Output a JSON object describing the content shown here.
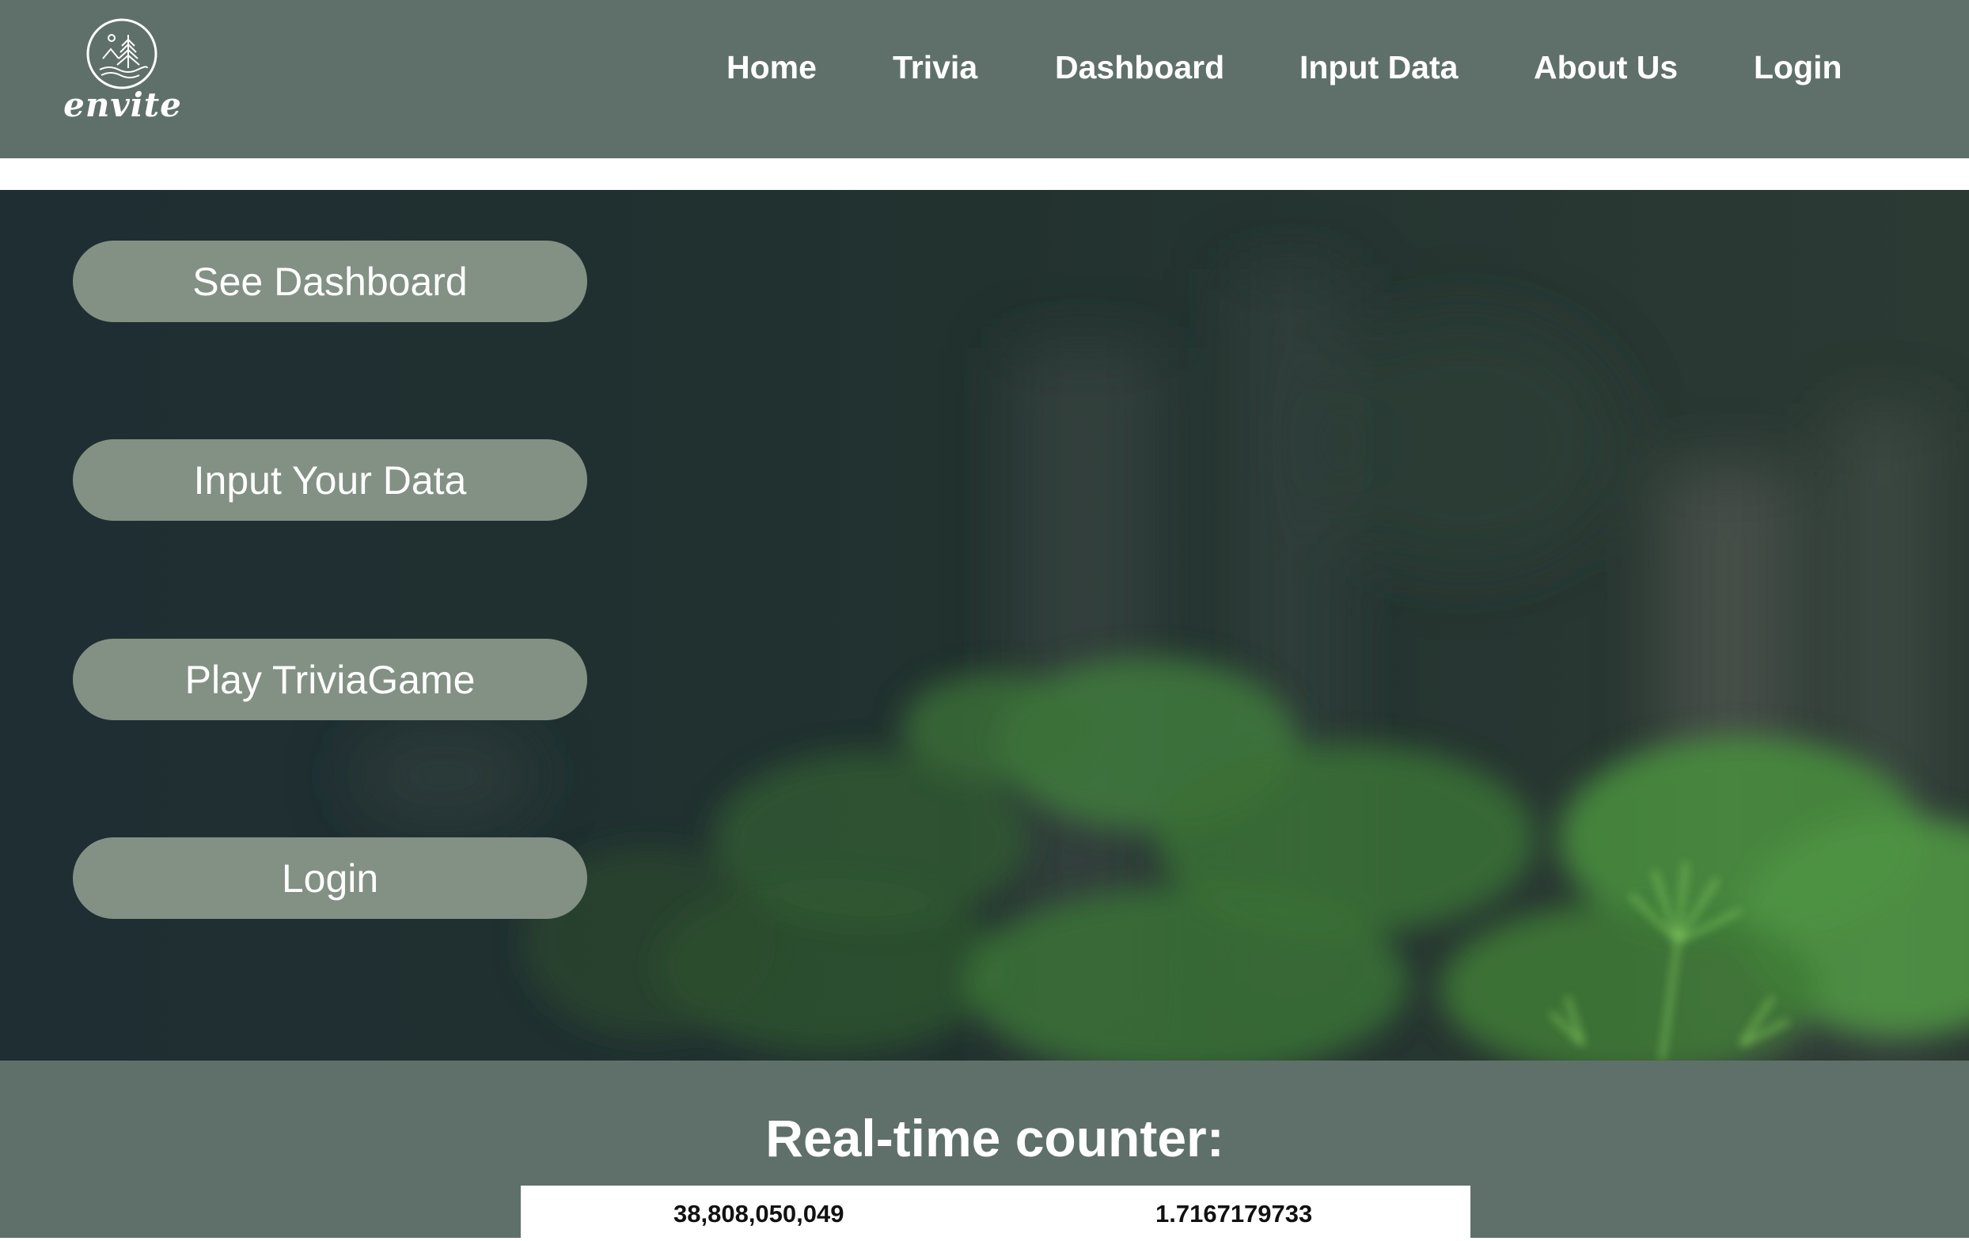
{
  "brand": {
    "name": "envite",
    "logo_icon": "tree-mountain-emblem-icon"
  },
  "nav": {
    "items": [
      {
        "label": "Home"
      },
      {
        "label": "Trivia"
      },
      {
        "label": "Dashboard"
      },
      {
        "label": "Input Data"
      },
      {
        "label": "About Us"
      },
      {
        "label": "Login"
      }
    ]
  },
  "hero": {
    "background": "blurred-forest-pine-photo",
    "buttons": [
      {
        "label": "See Dashboard"
      },
      {
        "label": "Input Your Data"
      },
      {
        "label": "Play TriviaGame"
      },
      {
        "label": "Login"
      }
    ]
  },
  "counter": {
    "title": "Real-time counter:",
    "values": [
      "38,808,050,049",
      "1.7167179733"
    ]
  },
  "colors": {
    "header_bg": "#5f706a",
    "button_bg": "#829184",
    "text_light": "#ffffff"
  }
}
